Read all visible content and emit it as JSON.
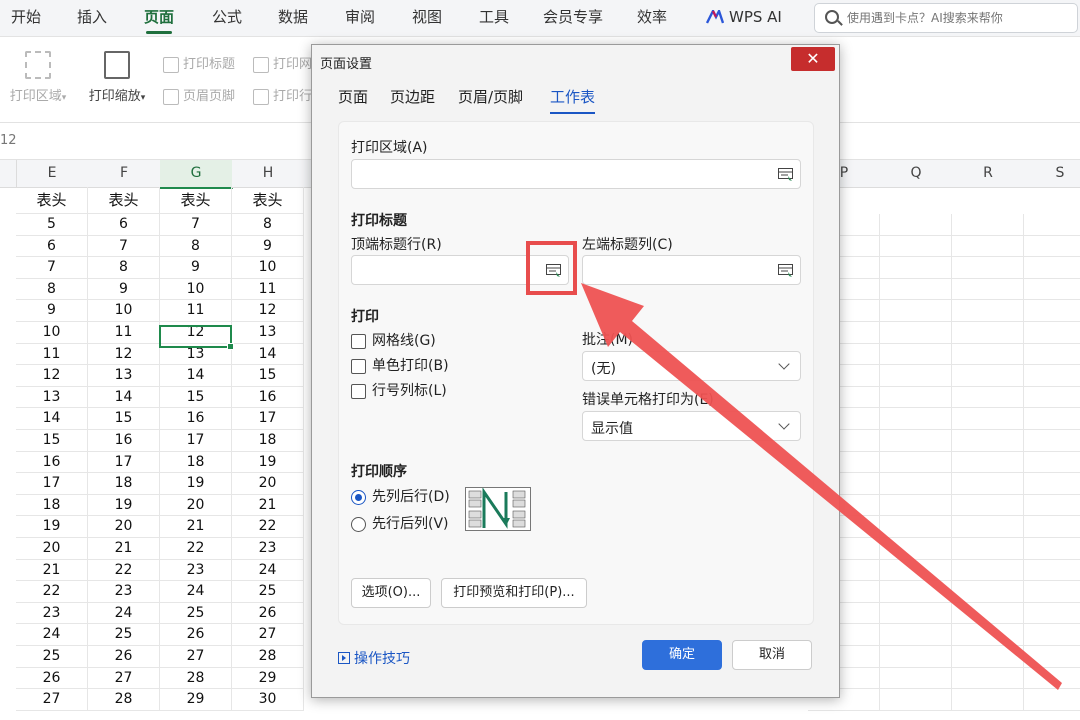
{
  "menubar": {
    "items": [
      "开始",
      "插入",
      "页面",
      "公式",
      "数据",
      "审阅",
      "视图",
      "工具",
      "会员专享",
      "效率"
    ],
    "active_index": 2,
    "wps_ai": "WPS AI",
    "search_placeholder": "使用遇到卡点？AI搜索来帮你"
  },
  "ribbon": {
    "print_area": "打印区域",
    "print_scale": "打印缩放",
    "print_titles": "打印标题",
    "header_footer": "页眉页脚",
    "print_grid": "打印网",
    "print_rowcol": "打印行"
  },
  "namebar": {
    "partial_text": "12"
  },
  "grid": {
    "columns": [
      "E",
      "F",
      "G",
      "H",
      "",
      "",
      "",
      "P",
      "Q",
      "R",
      "S"
    ],
    "selected_column": "G",
    "header_label": "表头",
    "rows": [
      [
        "5",
        "6",
        "7",
        "8"
      ],
      [
        "6",
        "7",
        "8",
        "9"
      ],
      [
        "7",
        "8",
        "9",
        "10"
      ],
      [
        "8",
        "9",
        "10",
        "11"
      ],
      [
        "9",
        "10",
        "11",
        "12"
      ],
      [
        "10",
        "11",
        "12",
        "13"
      ],
      [
        "11",
        "12",
        "13",
        "14"
      ],
      [
        "12",
        "13",
        "14",
        "15"
      ],
      [
        "13",
        "14",
        "15",
        "16"
      ],
      [
        "14",
        "15",
        "16",
        "17"
      ],
      [
        "15",
        "16",
        "17",
        "18"
      ],
      [
        "16",
        "17",
        "18",
        "19"
      ],
      [
        "17",
        "18",
        "19",
        "20"
      ],
      [
        "18",
        "19",
        "20",
        "21"
      ],
      [
        "19",
        "20",
        "21",
        "22"
      ],
      [
        "20",
        "21",
        "22",
        "23"
      ],
      [
        "21",
        "22",
        "23",
        "24"
      ],
      [
        "22",
        "23",
        "24",
        "25"
      ],
      [
        "23",
        "24",
        "25",
        "26"
      ],
      [
        "24",
        "25",
        "26",
        "27"
      ],
      [
        "25",
        "26",
        "27",
        "28"
      ],
      [
        "26",
        "27",
        "28",
        "29"
      ],
      [
        "27",
        "28",
        "29",
        "30"
      ]
    ]
  },
  "dialog": {
    "title": "页面设置",
    "close_symbol": "✕",
    "tabs": [
      "页面",
      "页边距",
      "页眉/页脚",
      "工作表"
    ],
    "active_tab": "工作表",
    "print_area_label": "打印区域(A)",
    "print_area_value": "",
    "print_titles_heading": "打印标题",
    "top_rows_label": "顶端标题行(R)",
    "top_rows_value": "",
    "left_cols_label": "左端标题列(C)",
    "left_cols_value": "",
    "print_heading": "打印",
    "gridlines_label": "网格线(G)",
    "mono_label": "单色打印(B)",
    "rowcol_label": "行号列标(L)",
    "comments_label": "批注(M)",
    "comments_value": "(无)",
    "errors_label": "错误单元格打印为(E)",
    "errors_value": "显示值",
    "order_heading": "打印顺序",
    "order_down_then_over": "先列后行(D)",
    "order_over_then_down": "先行后列(V)",
    "order_selected": "先列后行(D)",
    "options_button": "选项(O)...",
    "preview_button": "打印预览和打印(P)...",
    "tips_link": "操作技巧",
    "ok_button": "确定",
    "cancel_button": "取消"
  },
  "colors": {
    "accent_green": "#1f6f3d",
    "accent_blue": "#2e6fdb",
    "annotation_red": "#e84d4d"
  }
}
